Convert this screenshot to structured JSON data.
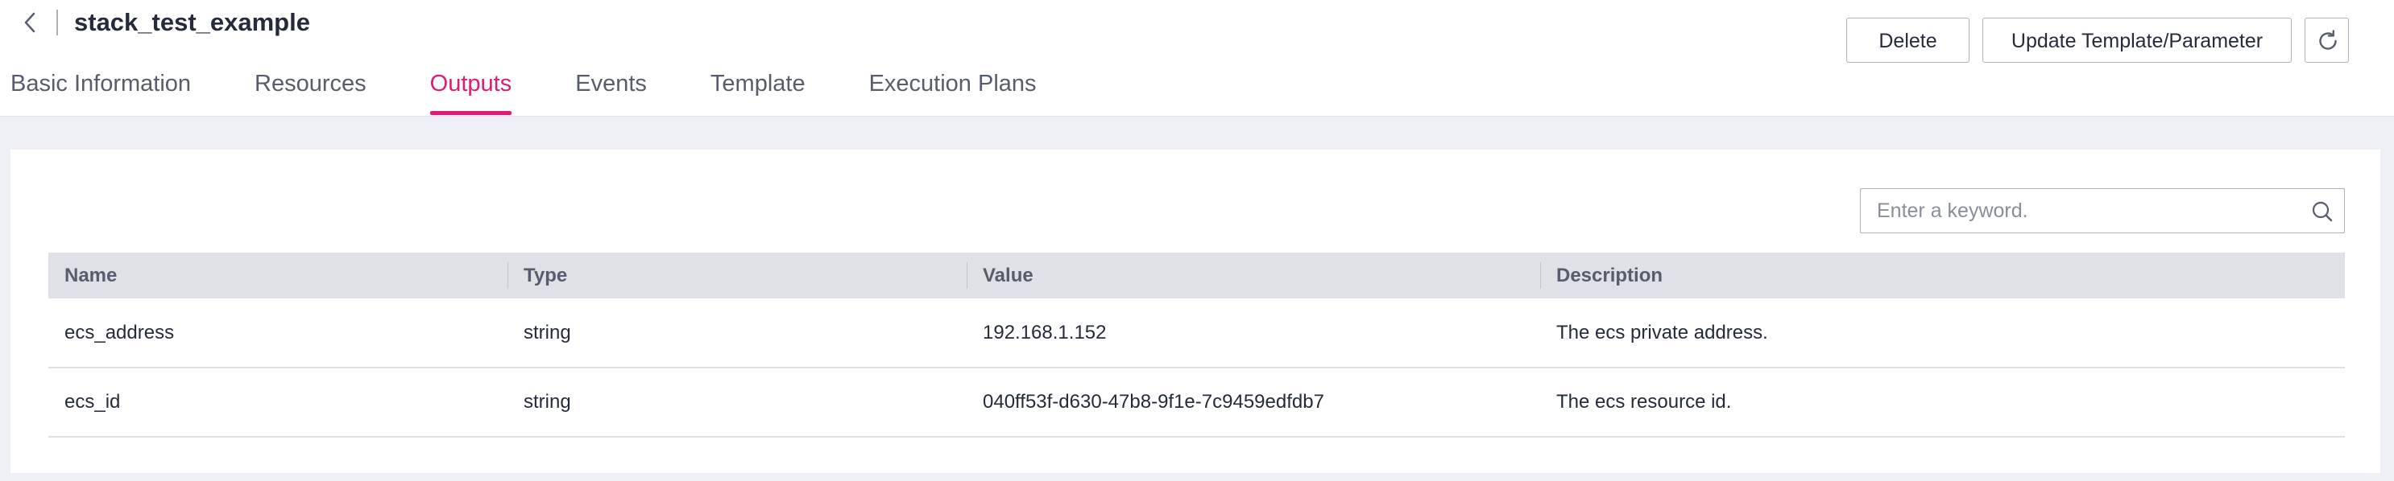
{
  "header": {
    "title": "stack_test_example",
    "back_icon": "chevron-left-icon"
  },
  "tabs": [
    {
      "label": "Basic Information",
      "active": false
    },
    {
      "label": "Resources",
      "active": false
    },
    {
      "label": "Outputs",
      "active": true
    },
    {
      "label": "Events",
      "active": false
    },
    {
      "label": "Template",
      "active": false
    },
    {
      "label": "Execution Plans",
      "active": false
    }
  ],
  "actions": {
    "delete_label": "Delete",
    "update_label": "Update Template/Parameter",
    "refresh_icon": "refresh-icon"
  },
  "search": {
    "placeholder": "Enter a keyword.",
    "value": "",
    "icon": "search-icon"
  },
  "table": {
    "columns": [
      "Name",
      "Type",
      "Value",
      "Description"
    ],
    "rows": [
      [
        "ecs_address",
        "string",
        "192.168.1.152",
        "The ecs private address."
      ],
      [
        "ecs_id",
        "string",
        "040ff53f-d630-47b8-9f1e-7c9459edfdb7",
        "The ecs resource id."
      ]
    ]
  },
  "colors": {
    "accent": "#e01b73",
    "header_bg": "#dfe1e6",
    "page_bg": "#eef0f5"
  }
}
